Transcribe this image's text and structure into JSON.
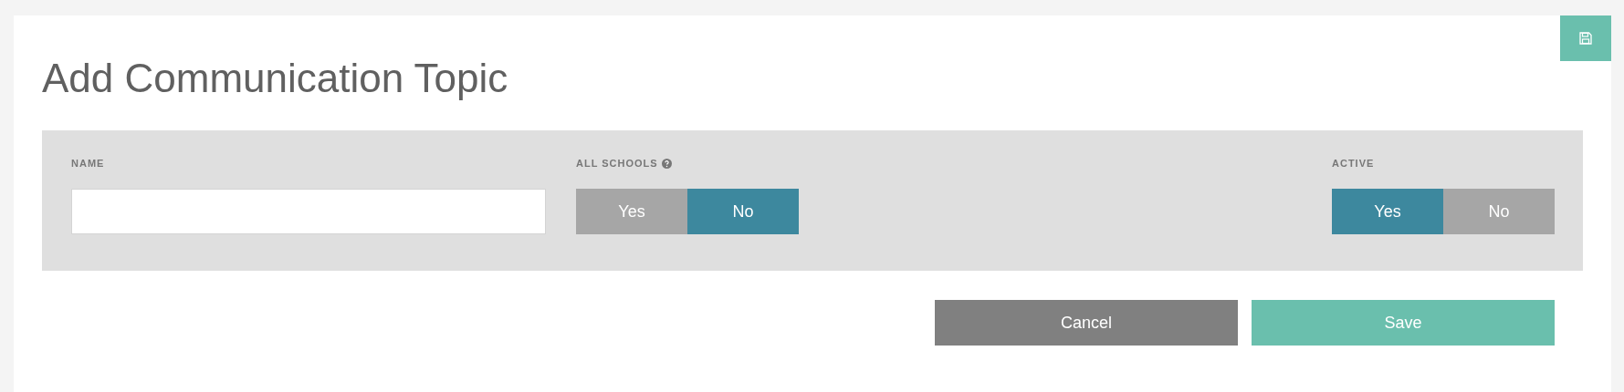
{
  "title": "Add Communication Topic",
  "fields": [
    {
      "kind": "text",
      "label": "NAME"
    },
    {
      "kind": "toggle",
      "label": "ALL SCHOOLS",
      "help": true,
      "options": [
        {
          "label": "Yes",
          "selected": false
        },
        {
          "label": "No",
          "selected": true
        }
      ]
    },
    {
      "kind": "toggle",
      "label": "ACTIVE",
      "help": false,
      "options": [
        {
          "label": "Yes",
          "selected": true
        },
        {
          "label": "No",
          "selected": false
        }
      ]
    }
  ],
  "buttons": [
    {
      "kind": "cancel",
      "label": "Cancel"
    },
    {
      "kind": "save",
      "label": "Save"
    }
  ]
}
